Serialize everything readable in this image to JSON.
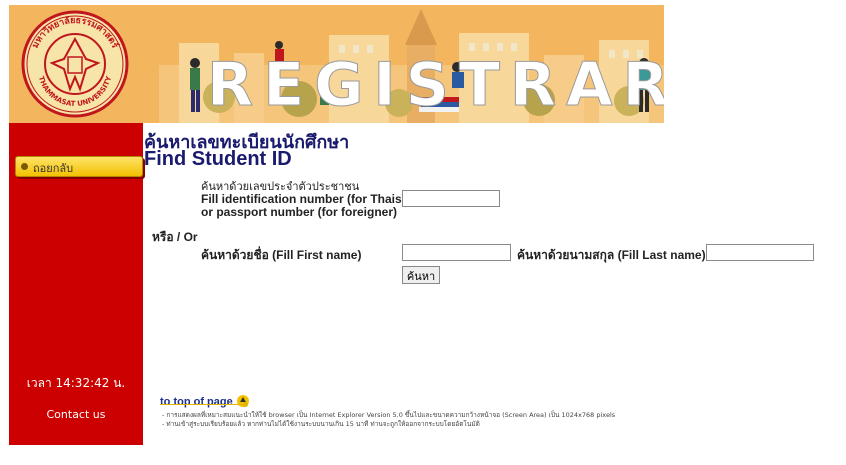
{
  "header": {
    "seal_text": "มหาวิทยาลัยธรรมศาสตร์",
    "seal_text_en": "THAMMASAT UNIVERSITY",
    "banner_title": "REGISTRAR"
  },
  "sidebar": {
    "back_label": "ถอยกลับ",
    "clock": "เวลา 14:32:42 น.",
    "contact": "Contact us"
  },
  "main": {
    "title_th": "ค้นหาเลขทะเบียนนักศึกษา",
    "title_en": "Find Student ID",
    "id_label_th": "ค้นหาด้วยเลขประจำตัวประชาชน",
    "id_label_en1": "Fill identification number (for Thais)",
    "id_label_en2": "or passport number (for foreigner)",
    "id_value": "",
    "or_label": "หรือ / Or",
    "first_label": "ค้นหาด้วยชื่อ (Fill First name)",
    "first_value": "",
    "last_label": "ค้นหาด้วยนามสกุล (Fill Last name)",
    "last_value": "",
    "search_button": "ค้นหา"
  },
  "footer": {
    "to_top": "to top of page",
    "note1": "- การแสดงผลที่เหมาะสมแนะนำให้ใช้ browser เป็น Internet Explorer Version 5.0 ขึ้นไปและขนาดความกว้างหน้าจอ (Screen Area) เป็น 1024x768 pixels",
    "note2": "- ท่านเข้าสู่ระบบเรียบร้อยแล้ว หากท่านไม่ได้ใช้งานระบบนานเกิน 15 นาที ท่านจะถูกให้ออกจากระบบโดยอัตโนมัติ"
  },
  "colors": {
    "header_bg": "#f3b55e",
    "sidebar_red": "#cc0000",
    "title_navy": "#1a1a6e",
    "button_yellow": "#f2c100"
  }
}
